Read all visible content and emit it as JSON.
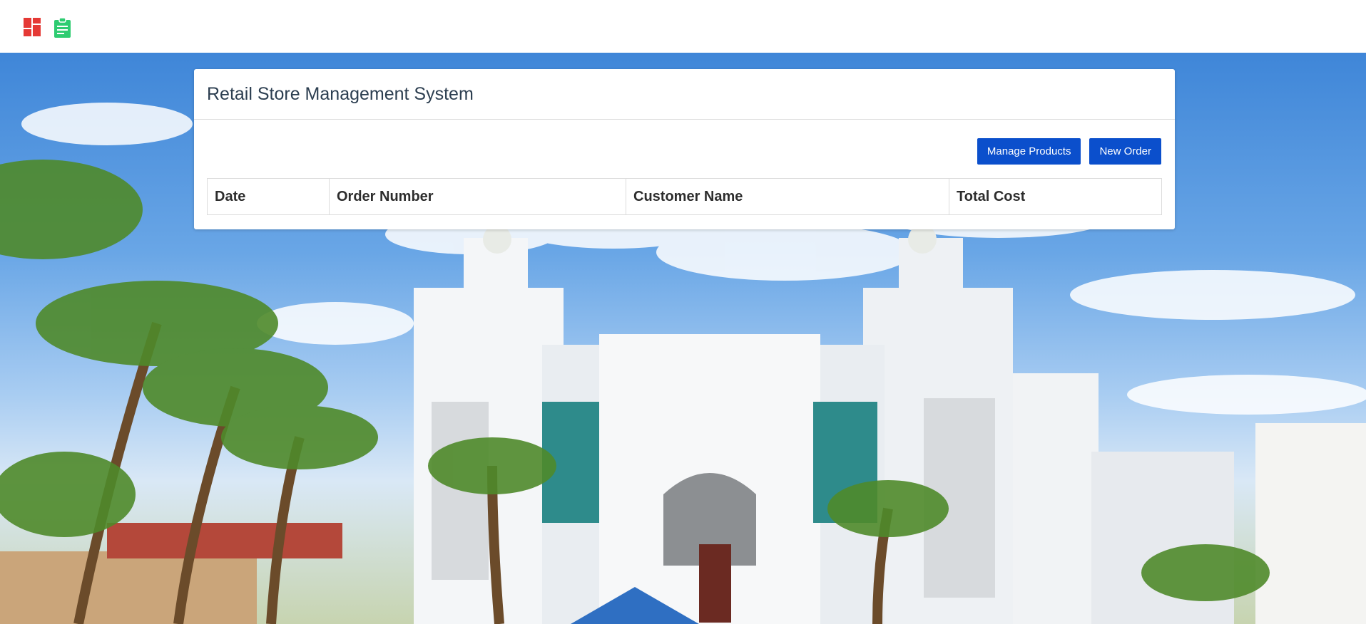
{
  "topbar": {
    "icons": [
      "dashboard-icon",
      "clipboard-icon"
    ],
    "colors": {
      "dashboard": "#e53935",
      "clipboard": "#2ecc71"
    }
  },
  "card": {
    "title": "Retail Store Management System",
    "buttons": {
      "manage_products": "Manage Products",
      "new_order": "New Order"
    },
    "table": {
      "columns": [
        "Date",
        "Order Number",
        "Customer Name",
        "Total Cost"
      ],
      "rows": []
    }
  },
  "colors": {
    "primary_button": "#0b4fcc",
    "title_text": "#2c3e50"
  }
}
